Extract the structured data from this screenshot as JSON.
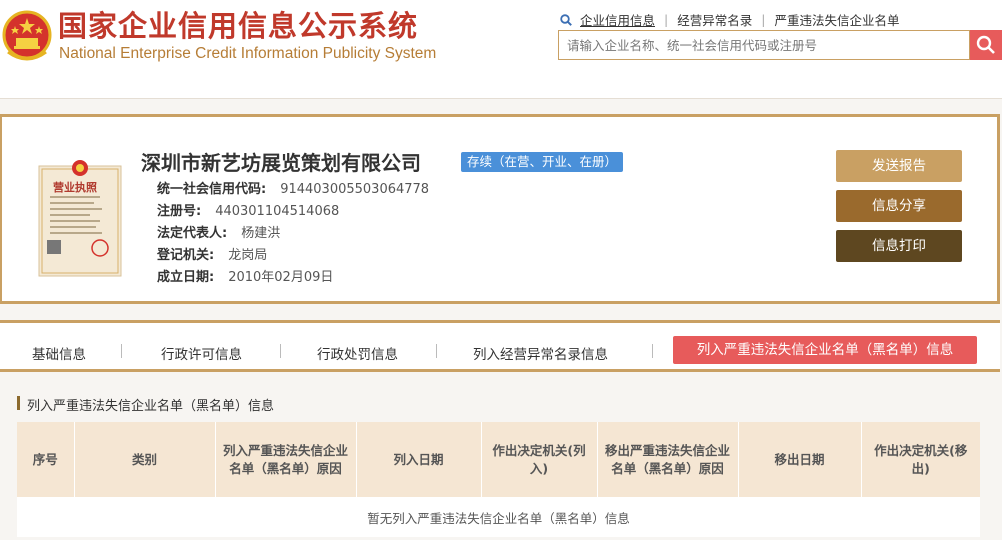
{
  "header": {
    "title_cn": "国家企业信用信息公示系统",
    "title_en": "National Enterprise Credit Information Publicity System",
    "links": [
      "企业信用信息",
      "经营异常名录",
      "严重违法失信企业名单"
    ],
    "search_placeholder": "请输入企业名称、统一社会信用代码或注册号"
  },
  "company": {
    "name": "深圳市新艺坊展览策划有限公司",
    "status": "存续（在营、开业、在册）",
    "license_label": "营业执照",
    "fields": [
      {
        "label": "统一社会信用代码:",
        "value": "914403005503064778"
      },
      {
        "label": "注册号:",
        "value": "440301104514068"
      },
      {
        "label": "法定代表人:",
        "value": "杨建洪"
      },
      {
        "label": "登记机关:",
        "value": "龙岗局"
      },
      {
        "label": "成立日期:",
        "value": "2010年02月09日"
      }
    ],
    "buttons": [
      "发送报告",
      "信息分享",
      "信息打印"
    ]
  },
  "tabs": [
    "基础信息",
    "行政许可信息",
    "行政处罚信息",
    "列入经营异常名录信息",
    "列入严重违法失信企业名单（黑名单）信息"
  ],
  "section": {
    "title": "列入严重违法失信企业名单（黑名单）信息",
    "columns": [
      "序号",
      "类别",
      "列入严重违法失信企业名单（黑名单）原因",
      "列入日期",
      "作出决定机关(列入)",
      "移出严重违法失信企业名单（黑名单）原因",
      "移出日期",
      "作出决定机关(移出)"
    ],
    "empty_text": "暂无列入严重违法失信企业名单（黑名单）信息"
  },
  "colors": {
    "gold": "#c9a063",
    "red": "#e75b5b",
    "title_red": "#c0392b",
    "badge_blue": "#4a90d9"
  }
}
